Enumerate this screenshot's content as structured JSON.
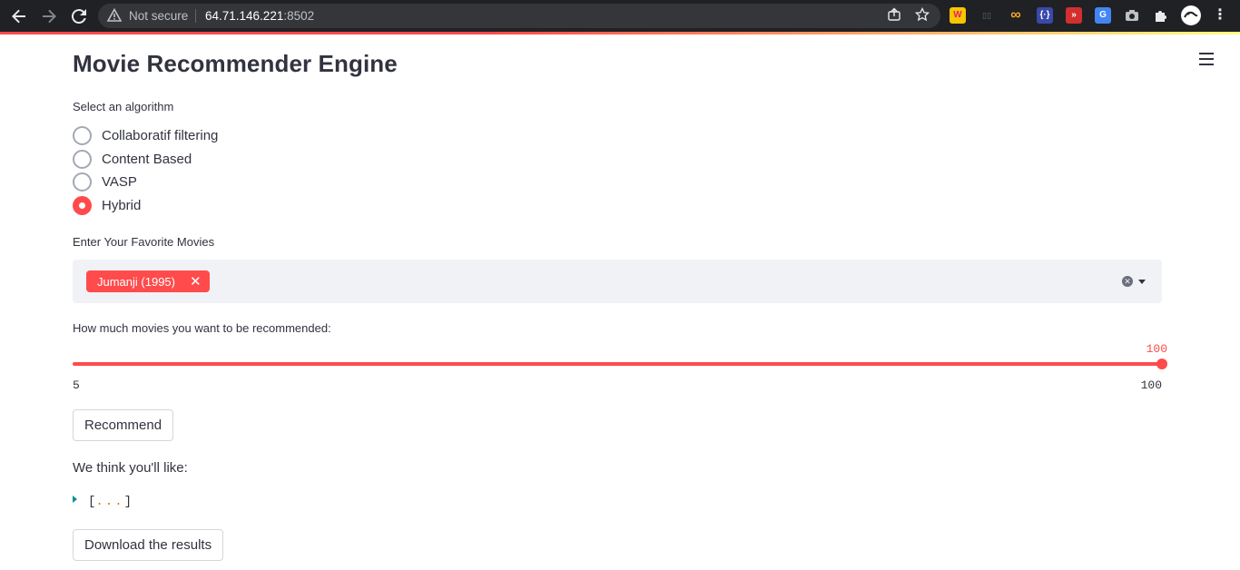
{
  "browser": {
    "security_label": "Not secure",
    "url_host": "64.71.146.221",
    "url_port": ":8502",
    "extensions": [
      {
        "name": "w-extension-icon",
        "glyph": "W",
        "color": "#e91e63"
      },
      {
        "name": "infinity-extension-icon",
        "glyph": "∞",
        "color": "#f9a825"
      },
      {
        "name": "json-extension-icon",
        "glyph": "{}",
        "color": "#3949ab"
      },
      {
        "name": "forward-extension-icon",
        "glyph": "»",
        "color": "#d32f2f"
      },
      {
        "name": "translate-extension-icon",
        "glyph": "G",
        "color": "#4285f4"
      }
    ]
  },
  "app": {
    "title": "Movie Recommender Engine",
    "algorithm": {
      "label": "Select an algorithm",
      "options": [
        "Collaboratif filtering",
        "Content Based",
        "VASP",
        "Hybrid"
      ],
      "selected": "Hybrid"
    },
    "favorites": {
      "label": "Enter Your Favorite Movies",
      "selected": [
        "Jumanji (1995)"
      ]
    },
    "count_slider": {
      "label": "How much movies you want to be recommended:",
      "value": "100",
      "min": "5",
      "max": "100"
    },
    "recommend_button": "Recommend",
    "results_label": "We think you'll like:",
    "results_open_bracket": "[",
    "results_ellipsis": "...",
    "results_close_bracket": "]",
    "download_button": "Download the results"
  },
  "colors": {
    "accent": "#ff4b4b",
    "text": "#31333f",
    "input_bg": "#f0f2f6"
  }
}
